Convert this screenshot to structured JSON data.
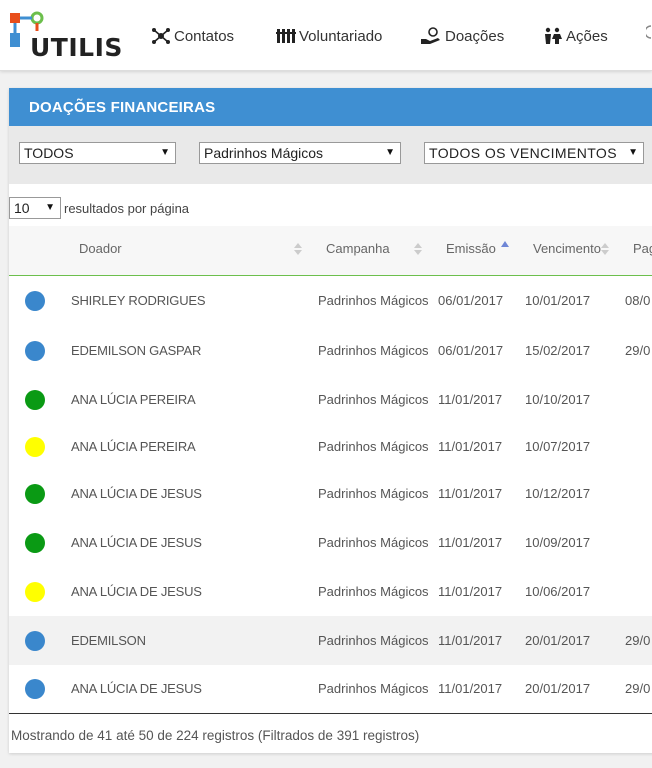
{
  "app": {
    "logo_text": "UTILIS",
    "brand_colors": [
      "#e84e1b",
      "#3f8fd2",
      "#6cbf4c"
    ]
  },
  "nav": [
    {
      "label": "Contatos",
      "icon": "contacts-network-icon"
    },
    {
      "label": "Voluntariado",
      "icon": "volunteers-icon"
    },
    {
      "label": "Doações",
      "icon": "donation-hand-icon"
    },
    {
      "label": "Ações",
      "icon": "actions-people-icon"
    }
  ],
  "panel": {
    "title": "DOAÇÕES FINANCEIRAS",
    "header_color": "#3f8fd2",
    "accent_color": "#6cbf4c"
  },
  "filters": {
    "status": "TODOS",
    "campaign": "Padrinhos Mágicos",
    "due": "TODOS OS VENCIMENTOS"
  },
  "page_length": {
    "value": "10",
    "label": "resultados por página"
  },
  "columns": {
    "donor": "Doador",
    "campaign": "Campanha",
    "issue": "Emissão",
    "due": "Vencimento",
    "paid": "Pag"
  },
  "rows": [
    {
      "status_color": "#3a87cc",
      "donor": "SHIRLEY RODRIGUES",
      "campaign": "Padrinhos Mágicos",
      "issue": "06/01/2017",
      "due": "10/01/2017",
      "paid": "08/0"
    },
    {
      "status_color": "#3a87cc",
      "donor": "EDEMILSON GASPAR",
      "campaign": "Padrinhos Mágicos",
      "issue": "06/01/2017",
      "due": "15/02/2017",
      "paid": "29/0"
    },
    {
      "status_color": "#0a9a14",
      "donor": "ANA LÚCIA PEREIRA",
      "campaign": "Padrinhos Mágicos",
      "issue": "11/01/2017",
      "due": "10/10/2017",
      "paid": ""
    },
    {
      "status_color": "#ffff00",
      "donor": "ANA LÚCIA PEREIRA",
      "campaign": "Padrinhos Mágicos",
      "issue": "11/01/2017",
      "due": "10/07/2017",
      "paid": ""
    },
    {
      "status_color": "#0a9a14",
      "donor": "ANA LÚCIA DE JESUS",
      "campaign": "Padrinhos Mágicos",
      "issue": "11/01/2017",
      "due": "10/12/2017",
      "paid": ""
    },
    {
      "status_color": "#0a9a14",
      "donor": "ANA LÚCIA DE JESUS",
      "campaign": "Padrinhos Mágicos",
      "issue": "11/01/2017",
      "due": "10/09/2017",
      "paid": ""
    },
    {
      "status_color": "#ffff00",
      "donor": "ANA LÚCIA DE JESUS",
      "campaign": "Padrinhos Mágicos",
      "issue": "11/01/2017",
      "due": "10/06/2017",
      "paid": ""
    },
    {
      "status_color": "#3a87cc",
      "donor": "EDEMILSON",
      "campaign": "Padrinhos Mágicos",
      "issue": "11/01/2017",
      "due": "20/01/2017",
      "paid": "29/0"
    },
    {
      "status_color": "#3a87cc",
      "donor": "ANA LÚCIA DE JESUS",
      "campaign": "Padrinhos Mágicos",
      "issue": "11/01/2017",
      "due": "20/01/2017",
      "paid": "29/0"
    }
  ],
  "info": "Mostrando de 41 até 50 de 224 registros (Filtrados de 391 registros)"
}
